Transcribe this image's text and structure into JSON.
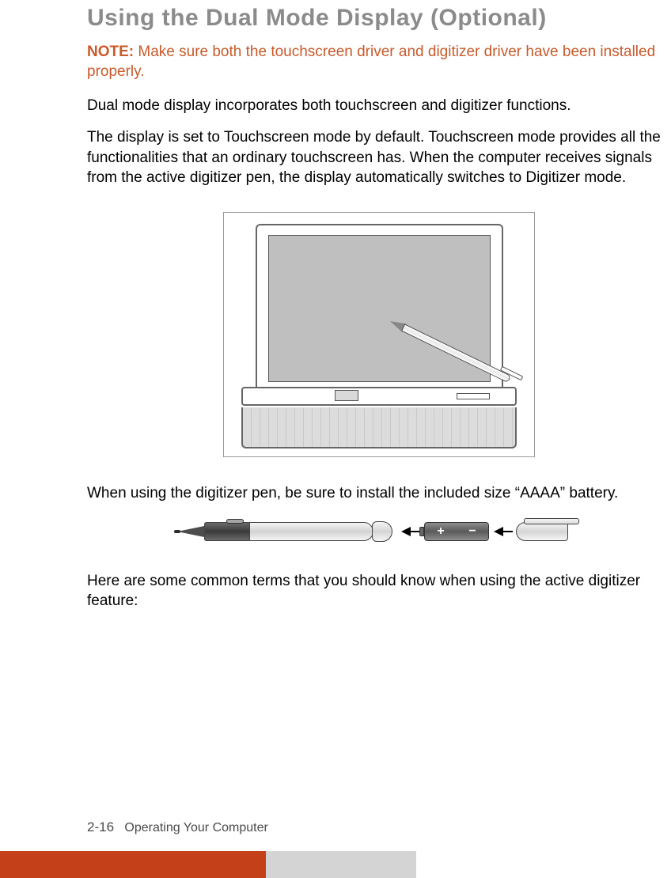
{
  "heading": "Using the Dual Mode Display (Optional)",
  "note": {
    "label": "NOTE:",
    "text": " Make sure both the touchscreen driver and digitizer driver have been installed properly."
  },
  "para1": "Dual mode display incorporates both touchscreen and digitizer functions.",
  "para2": "The display is set to Touchscreen mode by default. Touchscreen mode provides all the functionalities that an ordinary touchscreen has. When the computer receives signals from the active digitizer pen, the display automatically switches to Digitizer mode.",
  "para3": "When using the digitizer pen, be sure to install the included size “AAAA” battery.",
  "para4": "Here are some common terms that you should know when using the active digitizer feature:",
  "battery_plus": "+",
  "battery_minus": "−",
  "footer": {
    "page_number": "2-16",
    "chapter": "Operating Your Computer"
  }
}
